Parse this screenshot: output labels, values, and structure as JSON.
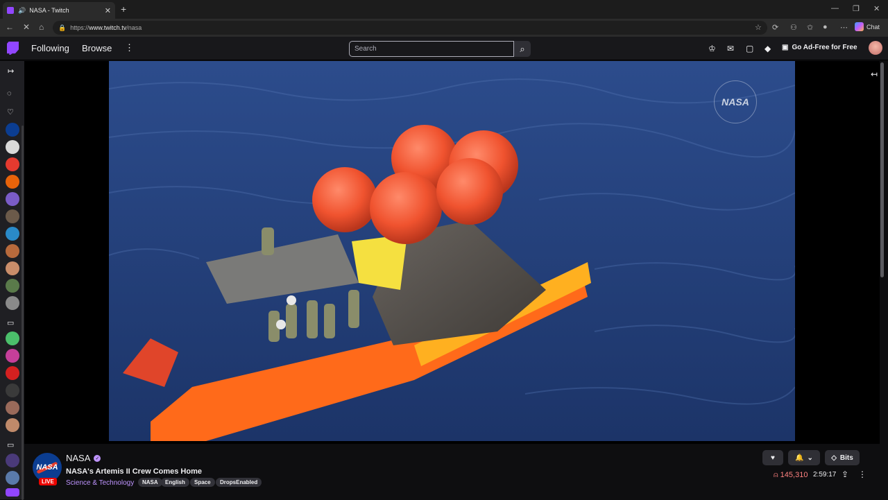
{
  "browser": {
    "tab_title": "NASA - Twitch",
    "url_host": "www.twitch.tv",
    "url_scheme": "https://",
    "url_path": "/nasa",
    "chat_label": "Chat"
  },
  "nav": {
    "following": "Following",
    "browse": "Browse",
    "search_placeholder": "Search",
    "ad_free": "Go Ad-Free for Free"
  },
  "video": {
    "watermark": "NASA"
  },
  "channel": {
    "name": "NASA",
    "avatar_text": "NASA",
    "live_badge": "LIVE",
    "stream_title": "NASA's Artemis II Crew Comes Home",
    "category": "Science & Technology",
    "tags": [
      "NASA",
      "English",
      "Space",
      "DropsEnabled"
    ],
    "bits_label": "Bits",
    "viewers": "145,310",
    "uptime": "2:59:17"
  },
  "colors": {
    "twitch_purple": "#9146ff",
    "live_red": "#eb0400",
    "viewer_red": "#ff8280"
  }
}
